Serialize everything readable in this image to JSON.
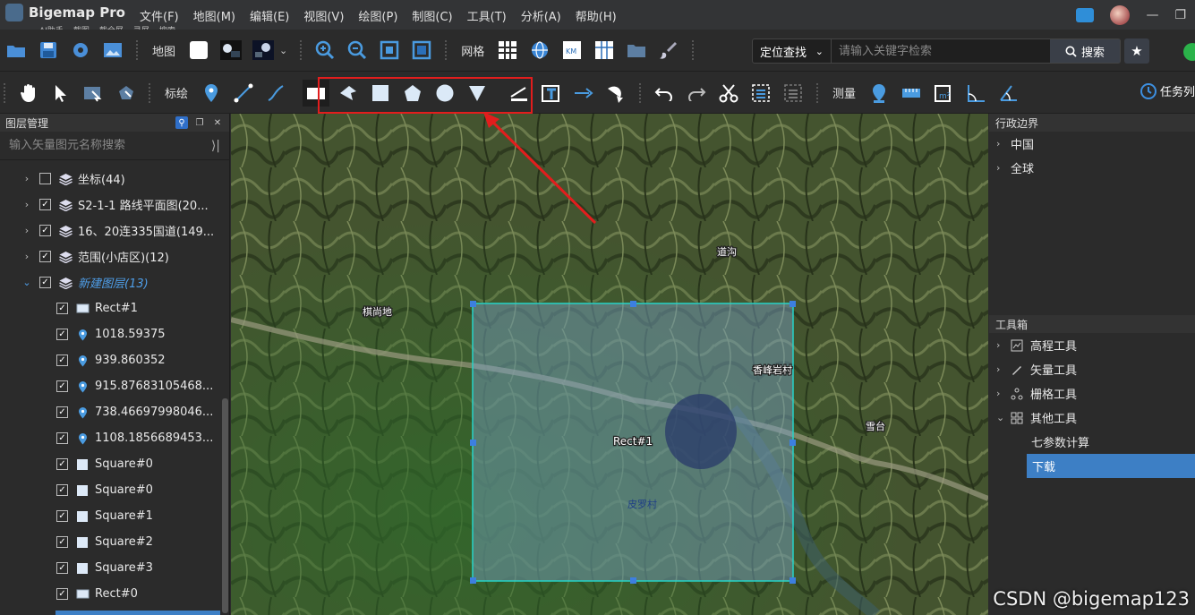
{
  "app": {
    "title": "Bigemap Pro"
  },
  "quick_tools": [
    "AI助手",
    "截图",
    "截全屏",
    "录屏",
    "搜索"
  ],
  "menus": [
    "文件(F)",
    "地图(M)",
    "编辑(E)",
    "视图(V)",
    "绘图(P)",
    "制图(C)",
    "工具(T)",
    "分析(A)",
    "帮助(H)"
  ],
  "toolbar1": {
    "map_label": "地图",
    "grid_label": "网格",
    "search_type": "定位查找",
    "search_placeholder": "请输入关键字检索",
    "search_button": "搜索"
  },
  "toolbar2": {
    "mark_label": "标绘",
    "measure_label": "测量",
    "task_label": "任务列"
  },
  "layer_panel": {
    "title": "图层管理",
    "search_placeholder": "输入矢量图元名称搜索",
    "layers": [
      {
        "label": "坐标(44)",
        "checked": false,
        "expanded": false
      },
      {
        "label": "S2-1-1 路线平面图(20...",
        "checked": true,
        "expanded": false
      },
      {
        "label": "16、20连335国道(149...",
        "checked": true,
        "expanded": false
      },
      {
        "label": "范围(小店区)(12)",
        "checked": true,
        "expanded": false
      },
      {
        "label": "新建图层(13)",
        "checked": true,
        "expanded": true
      }
    ],
    "children": [
      {
        "label": "Rect#1",
        "icon": "rect-icon"
      },
      {
        "label": "1018.59375",
        "icon": "pin-icon"
      },
      {
        "label": "939.860352",
        "icon": "pin-icon"
      },
      {
        "label": "915.87683105468...",
        "icon": "pin-icon"
      },
      {
        "label": "738.46697998046...",
        "icon": "pin-icon"
      },
      {
        "label": "1108.1856689453...",
        "icon": "pin-icon"
      },
      {
        "label": "Square#0",
        "icon": "square-icon"
      },
      {
        "label": "Square#0",
        "icon": "square-icon"
      },
      {
        "label": "Square#1",
        "icon": "square-icon"
      },
      {
        "label": "Square#2",
        "icon": "square-icon"
      },
      {
        "label": "Square#3",
        "icon": "square-icon"
      },
      {
        "label": "Rect#0",
        "icon": "rect-icon"
      }
    ]
  },
  "map": {
    "places": [
      "道沟",
      "棋尚地",
      "香峰岩村",
      "雪台",
      "皮罗村"
    ],
    "rect_label": "Rect#1"
  },
  "right_panel": {
    "boundary_title": "行政边界",
    "boundary_items": [
      "中国",
      "全球"
    ],
    "toolbox_title": "工具箱",
    "toolbox_items": [
      "高程工具",
      "矢量工具",
      "栅格工具",
      "其他工具"
    ],
    "other_tools": [
      "七参数计算",
      "下载"
    ]
  },
  "watermark": "CSDN @bigemap123",
  "colors": {
    "accent": "#3d7fc5",
    "highlight": "#e21d1d",
    "selection": "#26d4c8"
  }
}
